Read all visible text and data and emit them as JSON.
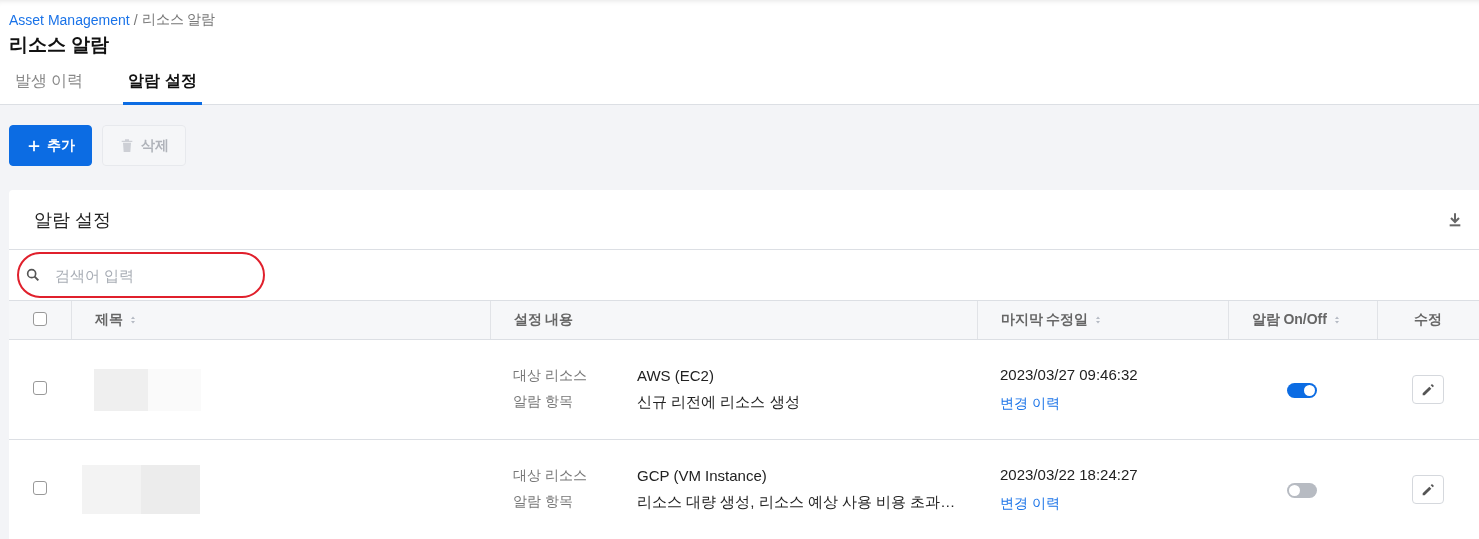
{
  "breadcrumb": {
    "link": "Asset Management",
    "separator": "/",
    "current": "리소스 알람"
  },
  "page_title": "리소스 알람",
  "tabs": [
    {
      "label": "발생 이력",
      "selected": false
    },
    {
      "label": "알람 설정",
      "selected": true
    }
  ],
  "toolbar": [
    {
      "label": "추가",
      "kind": "add",
      "disabled": false
    },
    {
      "label": "삭제",
      "kind": "delete",
      "disabled": true
    }
  ],
  "card": {
    "title": "알람 설정",
    "search": {
      "placeholder": "검색어 입력",
      "highlighted": true
    },
    "table": {
      "columns": [
        {
          "label": "제목",
          "sortable": true
        },
        {
          "label": "설정 내용",
          "sortable": false
        },
        {
          "label": "마지막 수정일",
          "sortable": true
        },
        {
          "label": "알람 On/Off",
          "sortable": true
        },
        {
          "label": "수정",
          "sortable": false
        }
      ],
      "all_checked": false,
      "rows": [
        {
          "checked": false,
          "settings": [
            {
              "label": "대상 리소스",
              "value": "AWS (EC2)"
            },
            {
              "label": "알람 항목",
              "value": "신규 리전에 리소스 생성"
            }
          ],
          "modified": "2023/03/27 09:46:32",
          "history_link": "변경 이력",
          "on": true
        },
        {
          "checked": false,
          "settings": [
            {
              "label": "대상 리소스",
              "value": "GCP (VM Instance)"
            },
            {
              "label": "알람 항목",
              "value": "리소스 대량 생성, 리소스 예상 사용 비용 초과…"
            }
          ],
          "modified": "2023/03/22 18:24:27",
          "history_link": "변경 이력",
          "on": false
        }
      ]
    }
  }
}
